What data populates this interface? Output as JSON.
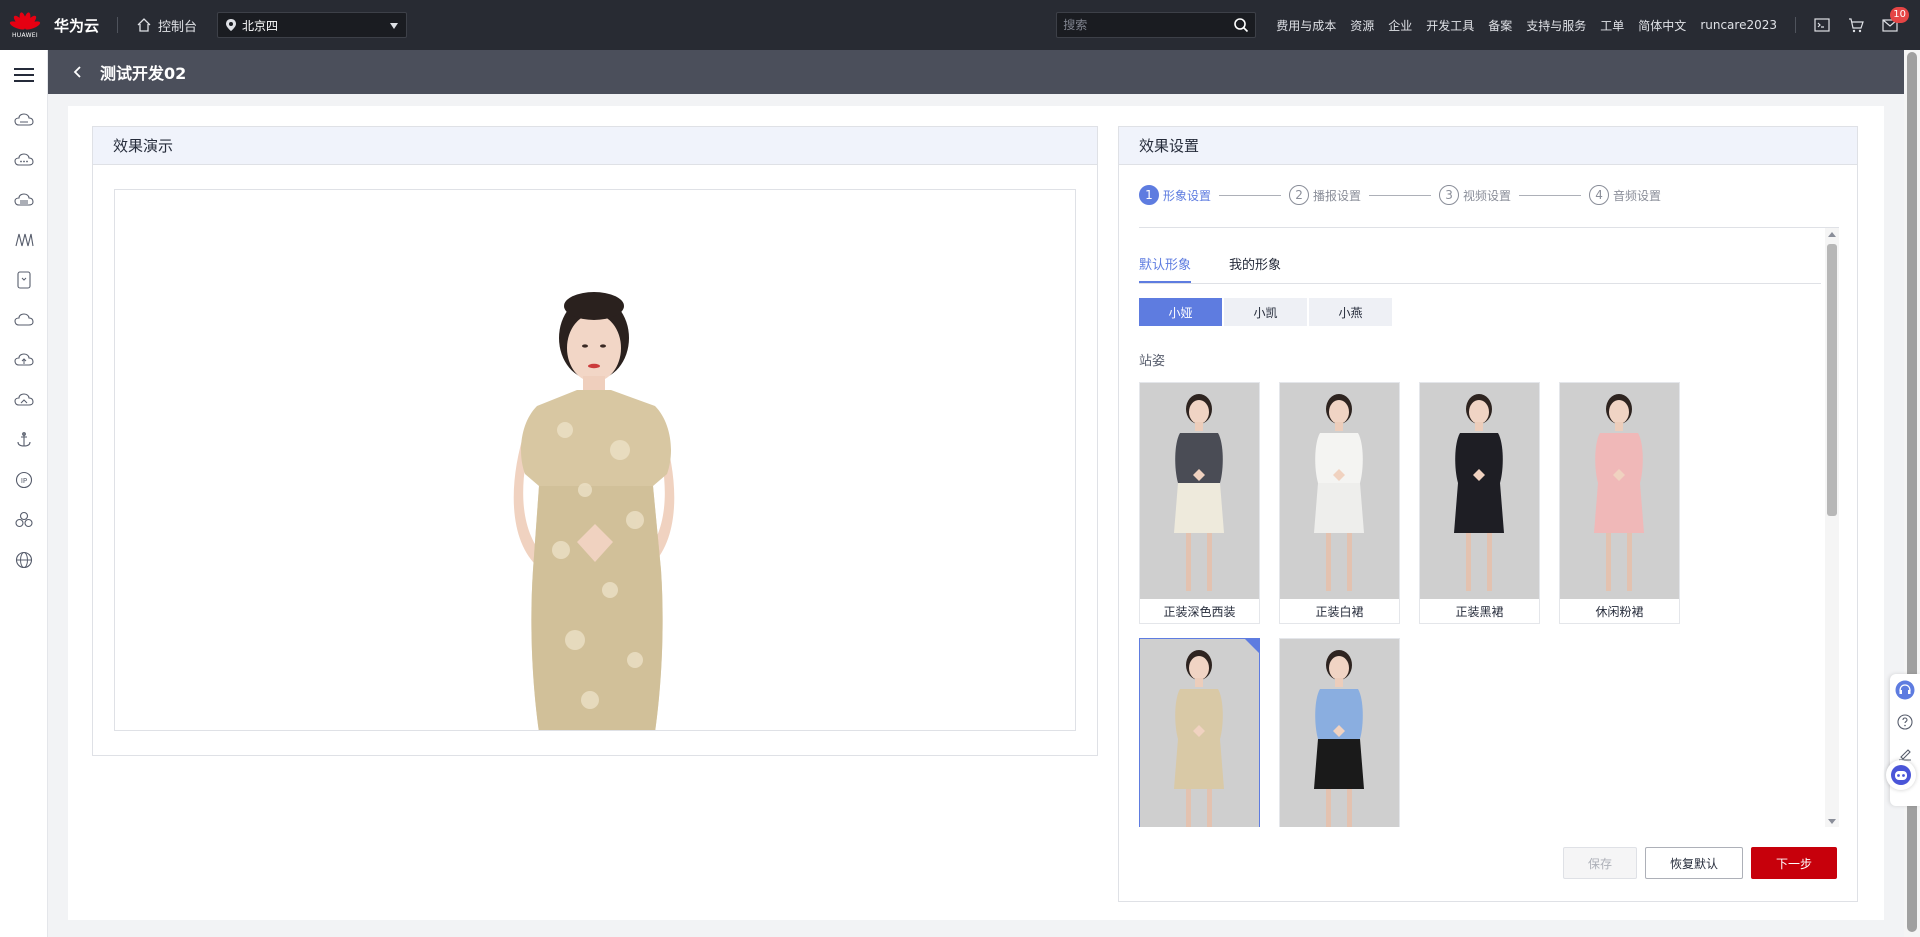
{
  "topbar": {
    "brand_name": "华为云",
    "brand_small": "HUAWEI",
    "console_label": "控制台",
    "region": "北京四",
    "search_placeholder": "搜索",
    "nav": [
      "费用与成本",
      "资源",
      "企业",
      "开发工具",
      "备案",
      "支持与服务",
      "工单",
      "简体中文",
      "runcare2023"
    ],
    "message_count": "10"
  },
  "sidebar": {
    "icons": [
      "cloud-server-icon",
      "cloud-more-icon",
      "cloud-storage-icon",
      "network-icon",
      "mobile-icon",
      "cloud-icon",
      "cloud-upload-icon",
      "cloud-sync-icon",
      "anchor-icon",
      "ip-icon",
      "cluster-icon",
      "globe-icon"
    ]
  },
  "subheader": {
    "title": "测试开发02"
  },
  "preview": {
    "title": "效果演示"
  },
  "settings": {
    "title": "效果设置",
    "steps": [
      {
        "num": "1",
        "label": "形象设置",
        "active": true
      },
      {
        "num": "2",
        "label": "播报设置",
        "active": false
      },
      {
        "num": "3",
        "label": "视频设置",
        "active": false
      },
      {
        "num": "4",
        "label": "音频设置",
        "active": false
      }
    ],
    "tabs": [
      {
        "label": "默认形象",
        "active": true
      },
      {
        "label": "我的形象",
        "active": false
      }
    ],
    "avatars": [
      {
        "label": "小娅",
        "active": true
      },
      {
        "label": "小凯",
        "active": false
      },
      {
        "label": "小燕",
        "active": false
      }
    ],
    "section_label": "站姿",
    "cards": [
      {
        "caption": "正装深色西装",
        "outfit": "#4a4c55",
        "skirt": "#eeeadc",
        "selected": false
      },
      {
        "caption": "正装白裙",
        "outfit": "#f4f4f2",
        "skirt": "#eeeeec",
        "selected": false
      },
      {
        "caption": "正装黑裙",
        "outfit": "#1e1e24",
        "skirt": "#1e1e24",
        "selected": false
      },
      {
        "caption": "休闲粉裙",
        "outfit": "#f0b8b8",
        "skirt": "#f0b8b8",
        "selected": false
      },
      {
        "caption": "",
        "outfit": "#d9c9a6",
        "skirt": "#d9c9a6",
        "selected": true
      },
      {
        "caption": "",
        "outfit": "#8aaee0",
        "skirt": "#1a1a1a",
        "selected": false
      }
    ],
    "buttons": {
      "save": "保存",
      "reset": "恢复默认",
      "next": "下一步"
    }
  },
  "colors": {
    "accent": "#5e7ce0",
    "primary_btn": "#c7000b",
    "topbar": "#282b33"
  }
}
